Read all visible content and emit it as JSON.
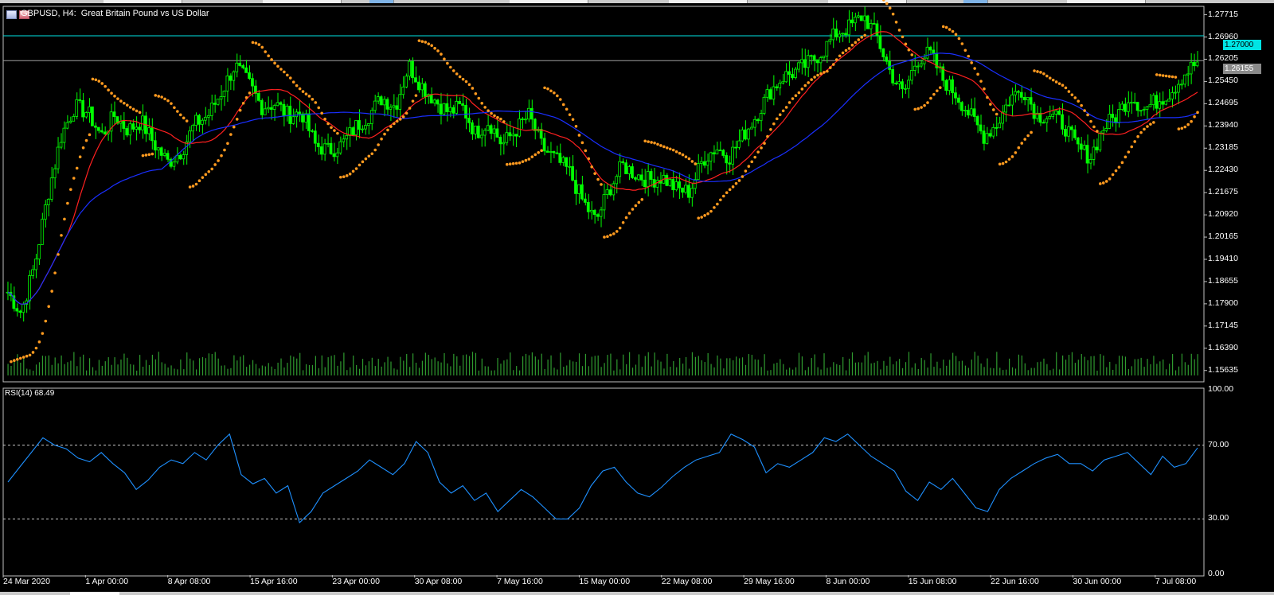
{
  "window": {
    "title": "GBPUSD, H4:  Great Britain Pound vs US Dollar"
  },
  "rsi_panel": {
    "label": "RSI(14) 68.49"
  },
  "price_axis": {
    "ticks": [
      "1.27715",
      "1.26960",
      "1.26205",
      "1.25450",
      "1.24695",
      "1.23940",
      "1.23185",
      "1.22430",
      "1.21675",
      "1.20920",
      "1.20165",
      "1.19410",
      "1.18655",
      "1.17900",
      "1.17145",
      "1.16390",
      "1.15635"
    ]
  },
  "rsi_axis": {
    "ticks": [
      "100.00",
      "70.00",
      "30.00",
      "0.00"
    ]
  },
  "time_axis": {
    "labels": [
      "24 Mar 2020",
      "1 Apr 00:00",
      "8 Apr 08:00",
      "15 Apr 16:00",
      "23 Apr 00:00",
      "30 Apr 08:00",
      "7 May 16:00",
      "15 May 00:00",
      "22 May 08:00",
      "29 May 16:00",
      "8 Jun 00:00",
      "15 Jun 08:00",
      "22 Jun 16:00",
      "30 Jun 00:00",
      "7 Jul 08:00"
    ]
  },
  "price_tags": {
    "resistance": "1.27000",
    "current": "1.26155"
  },
  "colors": {
    "background": "#000000",
    "bull_candle": "#00ff00",
    "bear_candle": "#00ff00",
    "volume": "#2f9a2f",
    "ma_fast": "#ff2020",
    "ma_slow": "#1a2fff",
    "parabolic_sar": "#ff9a1f",
    "rsi_line": "#1e90ff",
    "resistance_line": "#00e5e5",
    "current_line": "#a0a0a0"
  },
  "chart_data": [
    {
      "type": "candlestick",
      "title": "GBPUSD, H4:  Great Britain Pound vs US Dollar",
      "ylim": [
        1.1525,
        1.28
      ],
      "indicators": [
        "Moving Average (fast, red)",
        "Moving Average (slow, blue)",
        "Parabolic SAR",
        "Volumes"
      ],
      "horizontal_lines": [
        1.27,
        1.26155
      ],
      "x_labels": [
        "24 Mar 2020",
        "1 Apr 00:00",
        "8 Apr 08:00",
        "15 Apr 16:00",
        "23 Apr 00:00",
        "30 Apr 08:00",
        "7 May 16:00",
        "15 May 00:00",
        "22 May 08:00",
        "29 May 16:00",
        "8 Jun 00:00",
        "15 Jun 08:00",
        "22 Jun 16:00",
        "30 Jun 00:00",
        "7 Jul 08:00"
      ],
      "close_path": [
        1.183,
        1.176,
        1.192,
        1.216,
        1.236,
        1.246,
        1.244,
        1.236,
        1.243,
        1.238,
        1.241,
        1.233,
        1.227,
        1.231,
        1.24,
        1.243,
        1.251,
        1.26,
        1.254,
        1.246,
        1.247,
        1.243,
        1.244,
        1.233,
        1.231,
        1.233,
        1.239,
        1.243,
        1.249,
        1.246,
        1.26,
        1.253,
        1.248,
        1.244,
        1.246,
        1.237,
        1.241,
        1.233,
        1.238,
        1.243,
        1.232,
        1.228,
        1.224,
        1.214,
        1.207,
        1.218,
        1.226,
        1.223,
        1.221,
        1.222,
        1.218,
        1.217,
        1.228,
        1.232,
        1.229,
        1.236,
        1.243,
        1.251,
        1.256,
        1.258,
        1.261,
        1.265,
        1.271,
        1.273,
        1.277,
        1.27,
        1.258,
        1.25,
        1.262,
        1.264,
        1.255,
        1.25,
        1.243,
        1.236,
        1.24,
        1.249,
        1.252,
        1.243,
        1.243,
        1.24,
        1.232,
        1.229,
        1.239,
        1.243,
        1.25,
        1.245,
        1.248,
        1.251,
        1.257,
        1.261
      ]
    },
    {
      "type": "line",
      "title": "RSI(14) 68.49",
      "ylim": [
        0,
        100
      ],
      "levels": [
        70,
        30
      ],
      "last_value": 68.49,
      "values": [
        50,
        58,
        66,
        74,
        70,
        68,
        63,
        61,
        66,
        60,
        55,
        46,
        51,
        58,
        62,
        60,
        66,
        62,
        70,
        76,
        54,
        49,
        52,
        44,
        48,
        28,
        34,
        44,
        48,
        52,
        56,
        62,
        58,
        54,
        60,
        72,
        66,
        50,
        44,
        48,
        40,
        44,
        34,
        40,
        46,
        42,
        36,
        30,
        30,
        36,
        48,
        56,
        58,
        50,
        44,
        42,
        47,
        53,
        58,
        62,
        64,
        66,
        76,
        73,
        69,
        55,
        60,
        58,
        62,
        66,
        74,
        72,
        76,
        70,
        64,
        60,
        56,
        45,
        40,
        50,
        46,
        52,
        44,
        36,
        34,
        46,
        52,
        56,
        60,
        63,
        65,
        60,
        60,
        56,
        62,
        64,
        66,
        60,
        54,
        64,
        58,
        60,
        68.49
      ]
    }
  ]
}
